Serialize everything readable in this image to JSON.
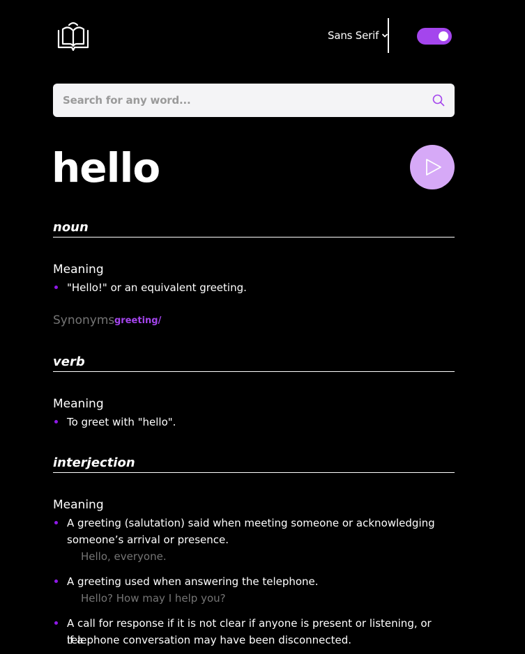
{
  "header": {
    "font_select_value": "Sans Serif"
  },
  "search": {
    "placeholder": "Search for any word..."
  },
  "entry": {
    "word": "hello",
    "meaning_label": "Meaning",
    "synonyms_label": "Synonyms",
    "sections": [
      {
        "part_of_speech": "noun",
        "definitions": [
          {
            "text": "\"Hello!\" or an equivalent greeting."
          }
        ],
        "synonyms": [
          "greeting/"
        ]
      },
      {
        "part_of_speech": "verb",
        "definitions": [
          {
            "text": "To greet with \"hello\"."
          }
        ]
      },
      {
        "part_of_speech": "interjection",
        "definitions": [
          {
            "text_line1": "A greeting (salutation) said when meeting someone or acknowledging",
            "text_line2": "someone’s arrival or presence.",
            "example": "Hello, everyone."
          },
          {
            "text": "A greeting used when answering the telephone.",
            "example": "Hello? How may I help you?"
          },
          {
            "text_line1": "A call for response if it is not clear if anyone is present or listening, or if a",
            "text_line2": "telephone conversation may have been disconnected."
          }
        ]
      }
    ]
  },
  "colors": {
    "accent": "#a445ed",
    "play_bg": "#d6a9f7",
    "muted_text": "#757575",
    "background": "#000000",
    "search_bg": "#f4f4f6"
  },
  "icons": {
    "logo": "book-icon",
    "dropdown": "chevron-down-icon",
    "search": "search-icon",
    "play": "play-icon"
  }
}
